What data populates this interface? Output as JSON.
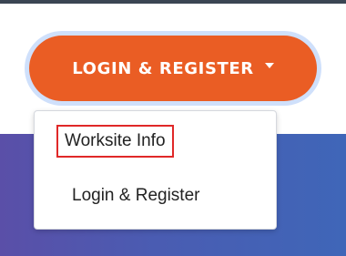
{
  "button": {
    "label": "LOGIN & REGISTER"
  },
  "menu": {
    "items": [
      {
        "label": "Worksite Info",
        "highlighted": true
      },
      {
        "label": "Login & Register",
        "highlighted": false
      }
    ]
  },
  "colors": {
    "button_bg": "#ea5d24",
    "focus_ring": "#cfe0fb",
    "highlight_border": "#e02828",
    "hero_gradient_start": "#5a4fa8",
    "hero_gradient_end": "#3f66b8"
  },
  "icons": {
    "dropdown": "caret-down-icon"
  }
}
